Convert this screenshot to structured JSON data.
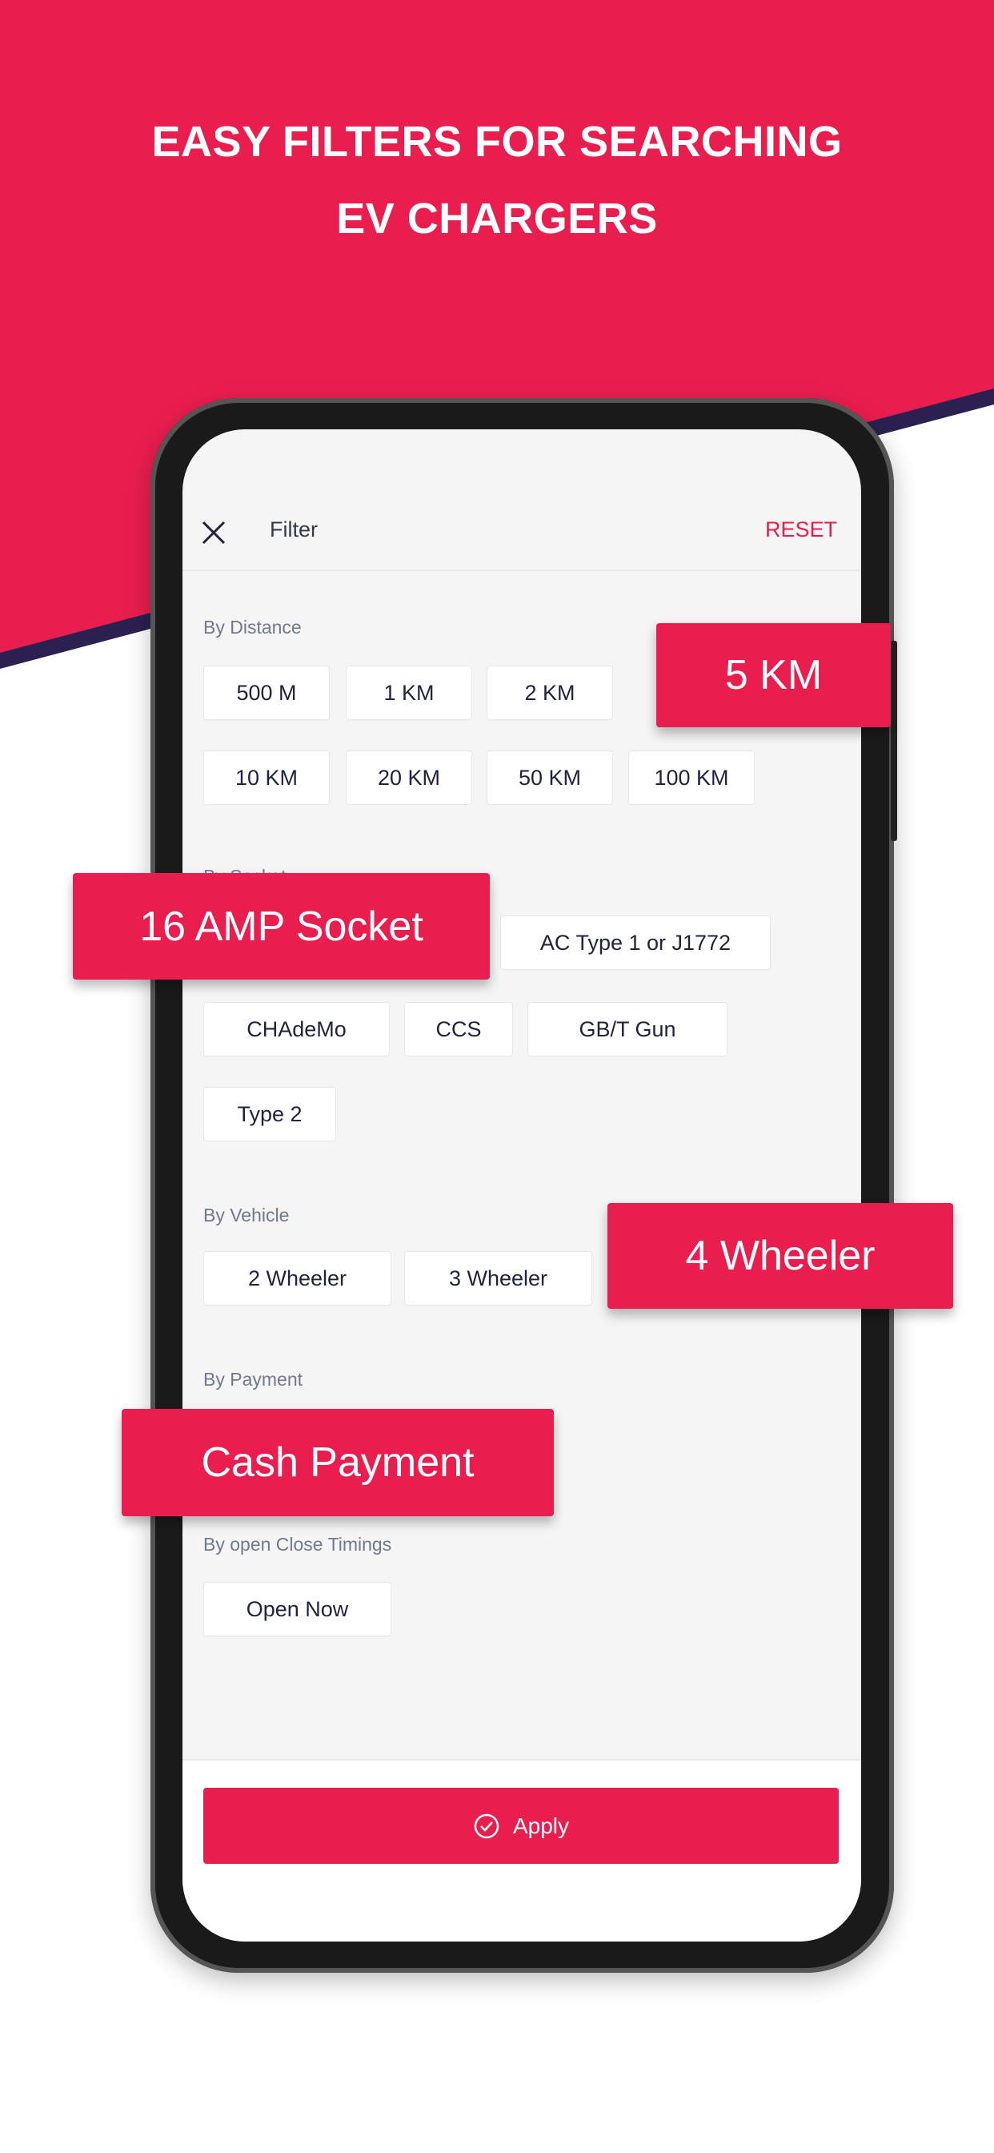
{
  "headline": {
    "line1": "EASY FILTERS FOR SEARCHING",
    "line2": "EV CHARGERS"
  },
  "colors": {
    "brand": "#e91e4f",
    "stripe": "#2a2150",
    "text": "#1f2340"
  },
  "header": {
    "close_icon": "close-icon",
    "title": "Filter",
    "reset_label": "RESET"
  },
  "sections": {
    "distance": {
      "label": "By Distance",
      "options": [
        "500 M",
        "1 KM",
        "2 KM",
        "10 KM",
        "20 KM",
        "50 KM",
        "100 KM"
      ]
    },
    "socket": {
      "label": "By Socket",
      "options": [
        "AC Type 1 or J1772",
        "CHAdeMo",
        "CCS",
        "GB/T Gun",
        "Type 2"
      ]
    },
    "vehicle": {
      "label": "By Vehicle",
      "options": [
        "2 Wheeler",
        "3 Wheeler"
      ]
    },
    "payment": {
      "label": "By Payment"
    },
    "timings": {
      "label": "By open Close Timings",
      "options": [
        "Open Now"
      ]
    }
  },
  "callouts": {
    "distance": "5 KM",
    "socket": "16 AMP Socket",
    "vehicle": "4 Wheeler",
    "payment": "Cash Payment"
  },
  "footer": {
    "apply_label": "Apply",
    "apply_icon": "check-circle-icon"
  }
}
